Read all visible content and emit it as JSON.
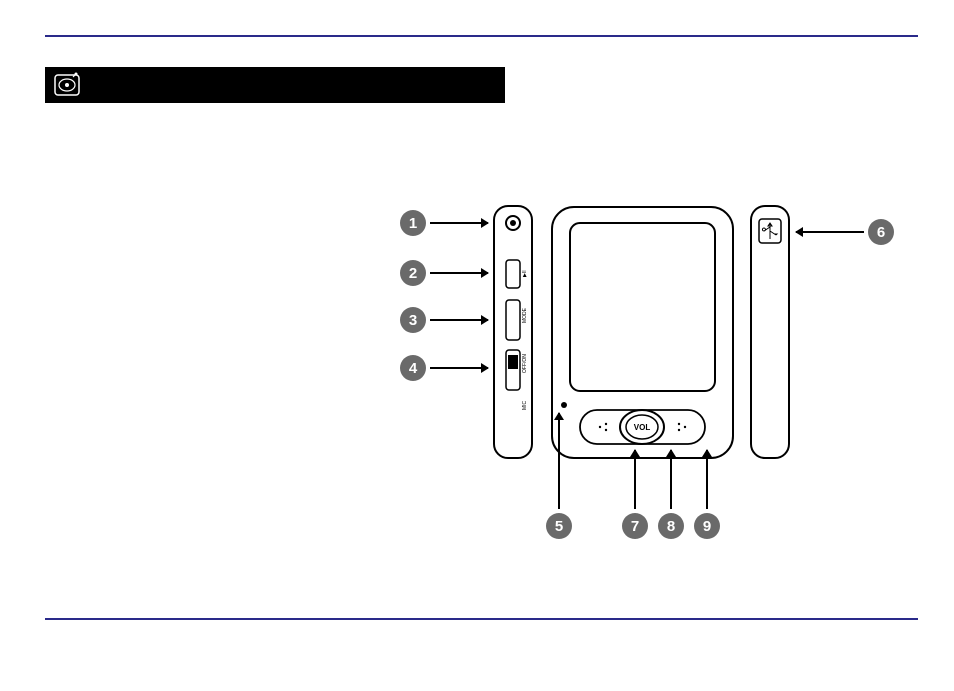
{
  "title_bar": {
    "icon": "device-location-icon"
  },
  "callouts": {
    "c1": "1",
    "c2": "2",
    "c3": "3",
    "c4": "4",
    "c5": "5",
    "c6": "6",
    "c7": "7",
    "c8": "8",
    "c9": "9"
  },
  "device_labels": {
    "side_mode": "MODE",
    "side_offon": "OFF/ON",
    "side_mic": "MIC",
    "front_vol": "VOL"
  }
}
